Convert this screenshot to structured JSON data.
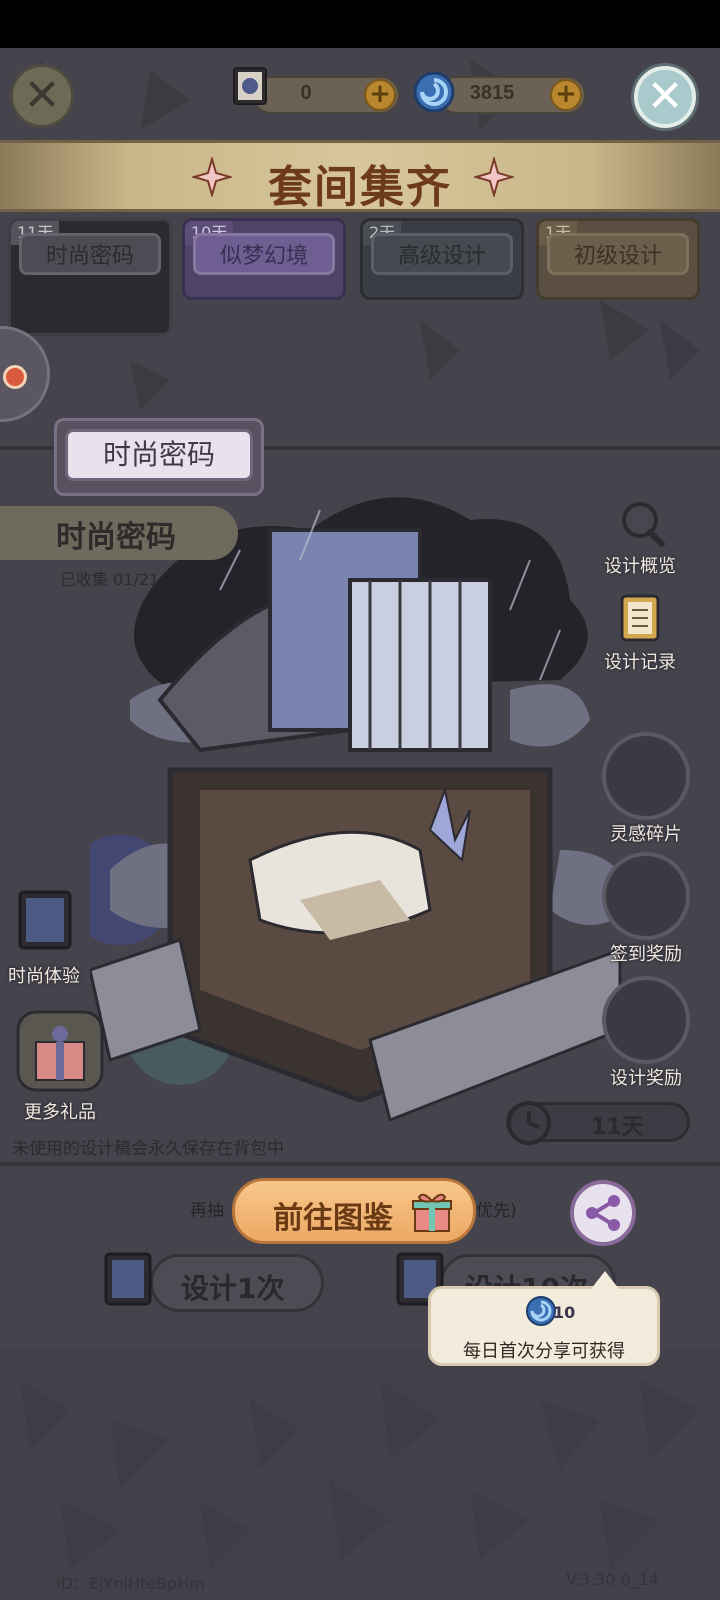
{
  "top_bar": {
    "ticket_count": "0",
    "gem_count": "3815"
  },
  "banner": {
    "title": "套间集齐"
  },
  "tabs": [
    {
      "days": "11天",
      "label": "时尚密码"
    },
    {
      "days": "10天",
      "label": "似梦幻境"
    },
    {
      "days": "2天",
      "label": "高级设计"
    },
    {
      "days": "1天",
      "label": "初级设计"
    }
  ],
  "set": {
    "sign_label": "时尚密码",
    "name": "时尚密码",
    "collected": "已收集 01/21"
  },
  "side_menu": {
    "overview": "设计概览",
    "records": "设计记录",
    "inspiration": "灵感碎片",
    "checkin": "签到奖励",
    "design_reward": "设计奖励"
  },
  "left_menu": {
    "fashion_exp": "时尚体验",
    "more_gifts": "更多礼品"
  },
  "remaining_days": "11天",
  "note": "未使用的设计稿会永久保存在背包中",
  "hidden_left": "再抽",
  "hidden_right": "优先)",
  "goto_button": "前往图鉴",
  "design_once": "设计1次",
  "design_ten": "设计10次",
  "tooltip": {
    "amount": "10",
    "message": "每日首次分享可获得"
  },
  "footer": {
    "id": "ID：EjYniHteBpHm",
    "version": "V.3.30.0_14"
  }
}
